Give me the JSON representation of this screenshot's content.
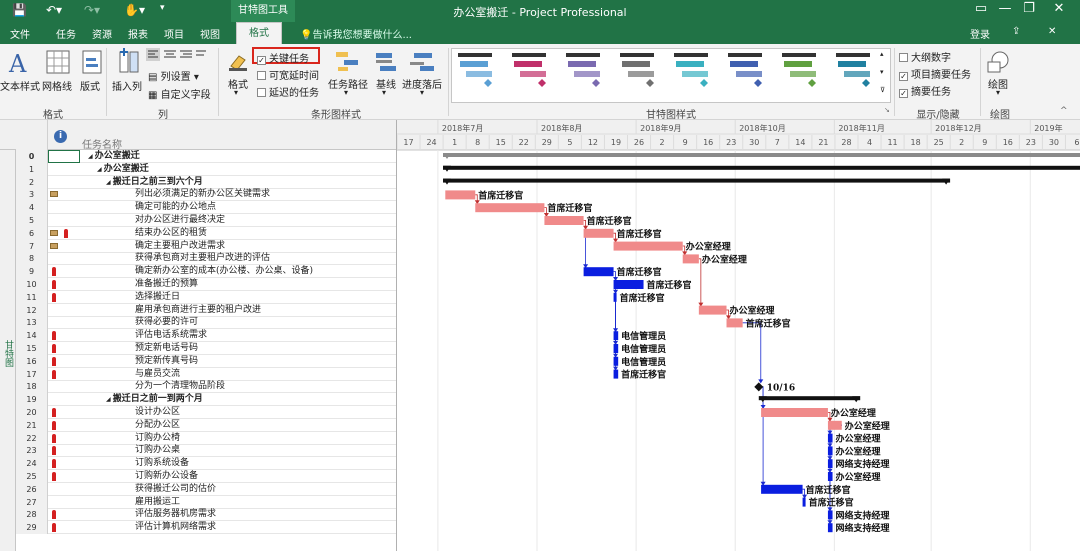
{
  "titlebar": {
    "context_tab": "甘特图工具",
    "title": "办公室搬迁 - Project Professional"
  },
  "menu": {
    "tabs": [
      "文件",
      "任务",
      "资源",
      "报表",
      "项目",
      "视图"
    ],
    "active_tab": "格式",
    "tell_me": "告诉我您想要做什么...",
    "login": "登录"
  },
  "ribbon": {
    "format_group": {
      "text_styles": "文本样式",
      "gridlines": "网格线",
      "layout": "版式",
      "label": "格式"
    },
    "columns_group": {
      "insert_column": "插入列",
      "column_settings": "列设置",
      "custom_fields": "自定义字段",
      "label": "列"
    },
    "bar_styles_group": {
      "format": "格式",
      "critical_tasks": "关键任务",
      "slack": "可宽延时间",
      "late_tasks": "延迟的任务",
      "task_path": "任务路径",
      "baseline": "基线",
      "slippage": "进度落后",
      "label": "条形图样式"
    },
    "gantt_styles_label": "甘特图样式",
    "showhide_group": {
      "outline_number": "大纲数字",
      "project_summary": "项目摘要任务",
      "summary_tasks": "摘要任务",
      "label": "显示/隐藏"
    },
    "drawing_group": {
      "drawing": "绘图",
      "label": "绘图"
    },
    "style_colors": [
      "#5a9fd4",
      "#c0306a",
      "#7a6ab0",
      "#707070",
      "#3ab0c0",
      "#4060b0",
      "#60a040",
      "#2080a0"
    ]
  },
  "table": {
    "column_header": "任务名称",
    "side_label": "甘特图",
    "rows": [
      {
        "id": "0",
        "name": "办公室搬迁",
        "level": 0,
        "summary": true,
        "icons": ""
      },
      {
        "id": "1",
        "name": "办公室搬迁",
        "level": 1,
        "summary": true,
        "icons": ""
      },
      {
        "id": "2",
        "name": "搬迁日之前三到六个月",
        "level": 2,
        "summary": true,
        "icons": ""
      },
      {
        "id": "3",
        "name": "列出必须满足的新办公区关键需求",
        "level": 3,
        "summary": false,
        "icons": "note"
      },
      {
        "id": "4",
        "name": "确定可能的办公地点",
        "level": 3,
        "summary": false,
        "icons": ""
      },
      {
        "id": "5",
        "name": "对办公区进行最终决定",
        "level": 3,
        "summary": false,
        "icons": ""
      },
      {
        "id": "6",
        "name": "结束办公区的租赁",
        "level": 3,
        "summary": false,
        "icons": "note-person"
      },
      {
        "id": "7",
        "name": "确定主要租户改进需求",
        "level": 3,
        "summary": false,
        "icons": "note"
      },
      {
        "id": "8",
        "name": "获得承包商对主要租户改进的评估",
        "level": 3,
        "summary": false,
        "icons": ""
      },
      {
        "id": "9",
        "name": "确定新办公室的成本(办公楼、办公桌、设备)",
        "level": 3,
        "summary": false,
        "icons": "person"
      },
      {
        "id": "10",
        "name": "准备搬迁的预算",
        "level": 3,
        "summary": false,
        "icons": "person"
      },
      {
        "id": "11",
        "name": "选择搬迁日",
        "level": 3,
        "summary": false,
        "icons": "person"
      },
      {
        "id": "12",
        "name": "雇用承包商进行主要的租户改进",
        "level": 3,
        "summary": false,
        "icons": ""
      },
      {
        "id": "13",
        "name": "获得必要的许可",
        "level": 3,
        "summary": false,
        "icons": ""
      },
      {
        "id": "14",
        "name": "评估电话系统需求",
        "level": 3,
        "summary": false,
        "icons": "person"
      },
      {
        "id": "15",
        "name": "预定新电话号码",
        "level": 3,
        "summary": false,
        "icons": "person"
      },
      {
        "id": "16",
        "name": "预定新传真号码",
        "level": 3,
        "summary": false,
        "icons": "person"
      },
      {
        "id": "17",
        "name": "与雇员交流",
        "level": 3,
        "summary": false,
        "icons": "person"
      },
      {
        "id": "18",
        "name": "分为一个清理物品阶段",
        "level": 3,
        "summary": false,
        "icons": ""
      },
      {
        "id": "19",
        "name": "搬迁日之前一到两个月",
        "level": 2,
        "summary": true,
        "icons": ""
      },
      {
        "id": "20",
        "name": "设计办公区",
        "level": 3,
        "summary": false,
        "icons": "person"
      },
      {
        "id": "21",
        "name": "分配办公区",
        "level": 3,
        "summary": false,
        "icons": "person"
      },
      {
        "id": "22",
        "name": "订购办公椅",
        "level": 3,
        "summary": false,
        "icons": "person"
      },
      {
        "id": "23",
        "name": "订购办公桌",
        "level": 3,
        "summary": false,
        "icons": "person"
      },
      {
        "id": "24",
        "name": "订购系统设备",
        "level": 3,
        "summary": false,
        "icons": "person"
      },
      {
        "id": "25",
        "name": "订购新办公设备",
        "level": 3,
        "summary": false,
        "icons": "person"
      },
      {
        "id": "26",
        "name": "获得搬迁公司的估价",
        "level": 3,
        "summary": false,
        "icons": ""
      },
      {
        "id": "27",
        "name": "雇用搬运工",
        "level": 3,
        "summary": false,
        "icons": ""
      },
      {
        "id": "28",
        "name": "评估服务器机房需求",
        "level": 3,
        "summary": false,
        "icons": "person"
      },
      {
        "id": "29",
        "name": "评估计算机网络需求",
        "level": 3,
        "summary": false,
        "icons": "person"
      }
    ]
  },
  "timescale": {
    "months": [
      "2018年7月",
      "2018年8月",
      "2018年9月",
      "2018年10月",
      "2018年11月",
      "2018年12月",
      "2019年"
    ],
    "days": [
      "17",
      "24",
      "1",
      "8",
      "15",
      "22",
      "29",
      "5",
      "12",
      "19",
      "26",
      "2",
      "9",
      "16",
      "23",
      "30",
      "7",
      "14",
      "21",
      "28",
      "4",
      "11",
      "18",
      "25",
      "2",
      "9",
      "16",
      "23",
      "30",
      "6"
    ]
  },
  "gantt": {
    "colors": {
      "critical": "#f08a8a",
      "normal": "#0a1ee0",
      "summary": "#111111",
      "project": "#8a8a8a",
      "link_critical": "#c03030",
      "link_normal": "#1a2ad0"
    },
    "tasks": [
      {
        "row": 0,
        "type": "project",
        "start": 0,
        "end": 37,
        "label": ""
      },
      {
        "row": 1,
        "type": "summary",
        "start": 0,
        "end": 37,
        "label": ""
      },
      {
        "row": 2,
        "type": "summary",
        "start": 0,
        "end": 22,
        "label": ""
      },
      {
        "row": 3,
        "type": "critical",
        "start": 0.1,
        "end": 1.4,
        "label": "首席迁移官"
      },
      {
        "row": 4,
        "type": "critical",
        "start": 1.4,
        "end": 4.4,
        "label": "首席迁移官"
      },
      {
        "row": 5,
        "type": "critical",
        "start": 4.4,
        "end": 6.1,
        "label": "首席迁移官"
      },
      {
        "row": 6,
        "type": "critical",
        "start": 6.1,
        "end": 7.4,
        "label": "首席迁移官"
      },
      {
        "row": 7,
        "type": "critical",
        "start": 7.4,
        "end": 10.4,
        "label": "办公室经理"
      },
      {
        "row": 8,
        "type": "critical",
        "start": 10.4,
        "end": 11.1,
        "label": "办公室经理"
      },
      {
        "row": 9,
        "type": "normal",
        "start": 6.1,
        "end": 7.4,
        "label": "首席迁移官"
      },
      {
        "row": 10,
        "type": "normal",
        "start": 7.4,
        "end": 8.7,
        "label": "首席迁移官"
      },
      {
        "row": 11,
        "type": "normal",
        "start": 7.4,
        "end": 7.5,
        "label": "首席迁移官"
      },
      {
        "row": 12,
        "type": "critical",
        "start": 11.1,
        "end": 12.3,
        "label": "办公室经理"
      },
      {
        "row": 13,
        "type": "critical",
        "start": 12.3,
        "end": 13.0,
        "label": "首席迁移官"
      },
      {
        "row": 14,
        "type": "normal",
        "start": 7.4,
        "end": 7.6,
        "label": "电信管理员"
      },
      {
        "row": 15,
        "type": "normal",
        "start": 7.4,
        "end": 7.6,
        "label": "电信管理员"
      },
      {
        "row": 16,
        "type": "normal",
        "start": 7.4,
        "end": 7.6,
        "label": "电信管理员"
      },
      {
        "row": 17,
        "type": "normal",
        "start": 7.4,
        "end": 7.6,
        "label": "首席迁移官"
      },
      {
        "row": 18,
        "type": "milestone",
        "start": 13.7,
        "end": 13.7,
        "label": "10/16"
      },
      {
        "row": 19,
        "type": "summary",
        "start": 13.7,
        "end": 18.1,
        "label": ""
      },
      {
        "row": 20,
        "type": "critical",
        "start": 13.8,
        "end": 16.7,
        "label": "办公室经理"
      },
      {
        "row": 21,
        "type": "critical",
        "start": 16.7,
        "end": 17.3,
        "label": "办公室经理"
      },
      {
        "row": 22,
        "type": "normal",
        "start": 16.7,
        "end": 16.9,
        "label": "办公室经理"
      },
      {
        "row": 23,
        "type": "normal",
        "start": 16.7,
        "end": 16.9,
        "label": "办公室经理"
      },
      {
        "row": 24,
        "type": "normal",
        "start": 16.7,
        "end": 16.9,
        "label": "网络支持经理"
      },
      {
        "row": 25,
        "type": "normal",
        "start": 16.7,
        "end": 16.9,
        "label": "办公室经理"
      },
      {
        "row": 26,
        "type": "normal",
        "start": 13.8,
        "end": 15.6,
        "label": "首席迁移官"
      },
      {
        "row": 27,
        "type": "normal",
        "start": 15.6,
        "end": 15.7,
        "label": "首席迁移官"
      },
      {
        "row": 28,
        "type": "normal",
        "start": 16.7,
        "end": 16.9,
        "label": "网络支持经理"
      },
      {
        "row": 29,
        "type": "normal",
        "start": 16.7,
        "end": 16.9,
        "label": "网络支持经理"
      }
    ]
  }
}
